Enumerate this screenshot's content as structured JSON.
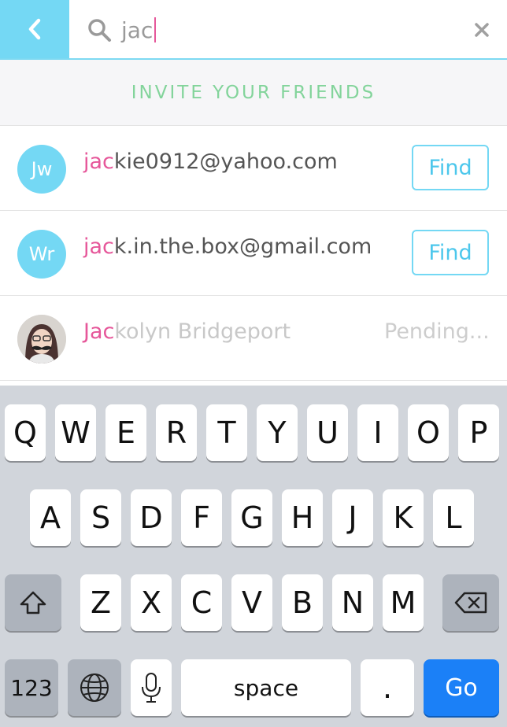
{
  "search": {
    "query": "jac",
    "back_icon": "chevron-left-icon",
    "search_icon": "search-icon",
    "clear_icon": "close-icon"
  },
  "invite": {
    "title": "INVITE YOUR FRIENDS"
  },
  "results": [
    {
      "initials": "Jw",
      "match": "jac",
      "rest": "kie0912@yahoo.com",
      "action": "Find"
    },
    {
      "initials": "Wr",
      "match": "jac",
      "rest": "k.in.the.box@gmail.com",
      "action": "Find"
    },
    {
      "initials": "",
      "match": "Jac",
      "rest": "kolyn Bridgeport",
      "status": "Pending..."
    }
  ],
  "keyboard": {
    "row1": [
      "Q",
      "W",
      "E",
      "R",
      "T",
      "Y",
      "U",
      "I",
      "O",
      "P"
    ],
    "row2": [
      "A",
      "S",
      "D",
      "F",
      "G",
      "H",
      "J",
      "K",
      "L"
    ],
    "row3": [
      "Z",
      "X",
      "C",
      "V",
      "B",
      "N",
      "M"
    ],
    "numbers_label": "123",
    "space_label": "space",
    "period_label": ".",
    "go_label": "Go"
  },
  "colors": {
    "accent": "#74d8f4",
    "highlight": "#e6579a",
    "invite_text": "#83d49b",
    "go_button": "#1b80f7"
  }
}
